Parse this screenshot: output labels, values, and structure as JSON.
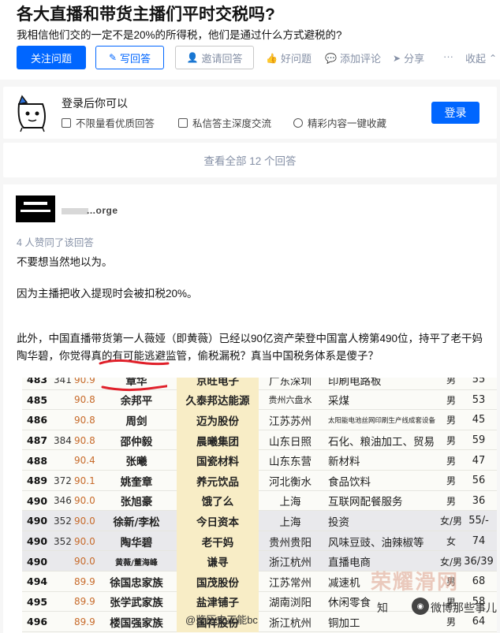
{
  "question": {
    "title": "各大直播和带货主播们平时交税吗?",
    "detail": "我相信他们交的一定不是20%的所得税，他们是通过什么方式避税的?",
    "actions": {
      "follow": "关注问题",
      "write": "写回答",
      "invite": "邀请回答",
      "good": "好问题",
      "comment": "添加评论",
      "share": "分享",
      "more": "···",
      "collapse": "收起"
    }
  },
  "login_prompt": {
    "title": "登录后你可以",
    "perks": [
      "不限量看优质回答",
      "私信答主深度交流",
      "精彩内容一键收藏"
    ],
    "button": "登录"
  },
  "view_all": "查看全部 12 个回答",
  "answer": {
    "author": "...orge",
    "upvotes": "4 人赞同了该回答",
    "paragraphs": [
      "不要想当然地以为。",
      "因为主播把收入提现时会被扣税20%。",
      "此外，中国直播带货第一人薇娅（即黄薇）已经以90亿资产荣登中国富人榜第490位，持平了老干妈陶华碧，你觉得真的有可能逃避监管，偷税漏税？真当中国税务体系是傻子？"
    ]
  },
  "rank_table": {
    "rows": [
      {
        "rank": "483",
        "age": "341",
        "wealth": "90.9",
        "name": "章华",
        "company": "京旺电子",
        "place": "广东深圳",
        "industry": "印刷电路板",
        "gender": "男",
        "num": "55"
      },
      {
        "rank": "485",
        "age": "",
        "wealth": "90.8",
        "name": "余邦平",
        "company": "久泰邦达能源",
        "place": "贵州六盘水",
        "industry": "采煤",
        "gender": "男",
        "num": "53"
      },
      {
        "rank": "486",
        "age": "",
        "wealth": "90.8",
        "name": "周剑",
        "company": "迈为股份",
        "place": "江苏苏州",
        "industry": "太阳能电池丝网印刷生产线成套设备",
        "gender": "男",
        "num": "45"
      },
      {
        "rank": "487",
        "age": "384",
        "wealth": "90.8",
        "name": "邵仲毅",
        "company": "晨曦集团",
        "place": "山东日照",
        "industry": "石化、粮油加工、贸易",
        "gender": "男",
        "num": "59"
      },
      {
        "rank": "488",
        "age": "",
        "wealth": "90.4",
        "name": "张曦",
        "company": "国瓷材料",
        "place": "山东东营",
        "industry": "新材料",
        "gender": "男",
        "num": "47"
      },
      {
        "rank": "489",
        "age": "372",
        "wealth": "90.1",
        "name": "姚奎章",
        "company": "养元饮品",
        "place": "河北衡水",
        "industry": "食品饮料",
        "gender": "男",
        "num": "56"
      },
      {
        "rank": "490",
        "age": "346",
        "wealth": "90.0",
        "name": "张旭豪",
        "company": "饿了么",
        "place": "上海",
        "industry": "互联网配餐服务",
        "gender": "男",
        "num": "36"
      },
      {
        "rank": "490",
        "age": "352",
        "wealth": "90.0",
        "name": "徐新/李松",
        "company": "今日资本",
        "place": "上海",
        "industry": "投资",
        "gender": "女/男",
        "num": "55/-"
      },
      {
        "rank": "490",
        "age": "352",
        "wealth": "90.0",
        "name": "陶华碧",
        "company": "老干妈",
        "place": "贵州贵阳",
        "industry": "风味豆豉、油辣椒等",
        "gender": "女",
        "num": "74"
      },
      {
        "rank": "490",
        "age": "",
        "wealth": "90.0",
        "name": "黄薇/董海峰",
        "company": "谦寻",
        "place": "浙江杭州",
        "industry": "直播电商",
        "gender": "女/男",
        "num": "36/39"
      },
      {
        "rank": "494",
        "age": "",
        "wealth": "89.9",
        "name": "徐国忠家族",
        "company": "国茂股份",
        "place": "江苏常州",
        "industry": "减速机",
        "gender": "男",
        "num": "68"
      },
      {
        "rank": "495",
        "age": "",
        "wealth": "89.9",
        "name": "张学武家族",
        "company": "盐津铺子",
        "place": "湖南浏阳",
        "industry": "休闲零食",
        "gender": "男",
        "num": "58"
      },
      {
        "rank": "496",
        "age": "",
        "wealth": "89.9",
        "name": "楼国强家族",
        "company": "国祥股份",
        "place": "浙江杭州",
        "industry": "铜加工",
        "gender": "男",
        "num": "64"
      }
    ]
  },
  "watermarks": {
    "brand": "荣耀滑网",
    "wechat": "微博那些事儿",
    "prefix": "知",
    "bottom": "@鉴历史正能bc"
  }
}
